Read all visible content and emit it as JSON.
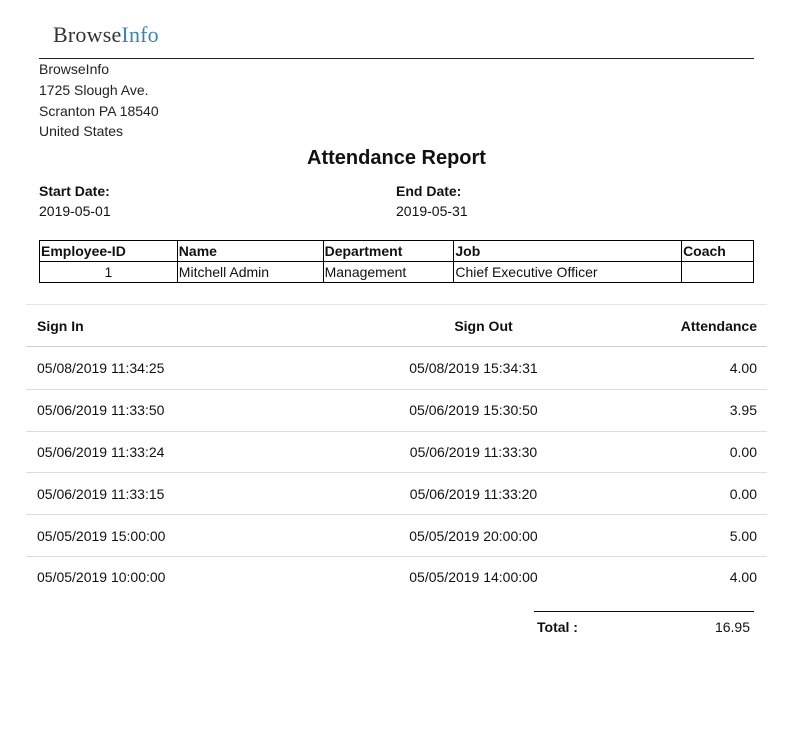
{
  "logo": {
    "part1": "Browse",
    "part2": "Info"
  },
  "address": {
    "company": "BrowseInfo",
    "street": "1725 Slough Ave.",
    "city": "Scranton PA 18540",
    "country": "United States"
  },
  "report": {
    "title": "Attendance Report",
    "start_label": "Start Date:",
    "start_value": "2019-05-01",
    "end_label": "End Date:",
    "end_value": "2019-05-31"
  },
  "employee_table": {
    "headers": [
      "Employee-ID",
      "Name",
      "Department",
      "Job",
      "Coach"
    ],
    "row": [
      "1",
      "Mitchell Admin",
      "Management",
      "Chief Executive Officer",
      ""
    ]
  },
  "attendance": {
    "headers": {
      "sign_in": "Sign In",
      "sign_out": "Sign Out",
      "attendance": "Attendance"
    },
    "rows": [
      {
        "sign_in": "05/08/2019 11:34:25",
        "sign_out": "05/08/2019 15:34:31",
        "attendance": "4.00"
      },
      {
        "sign_in": "05/06/2019 11:33:50",
        "sign_out": "05/06/2019 15:30:50",
        "attendance": "3.95"
      },
      {
        "sign_in": "05/06/2019 11:33:24",
        "sign_out": "05/06/2019 11:33:30",
        "attendance": "0.00"
      },
      {
        "sign_in": "05/06/2019 11:33:15",
        "sign_out": "05/06/2019 11:33:20",
        "attendance": "0.00"
      },
      {
        "sign_in": "05/05/2019 15:00:00",
        "sign_out": "05/05/2019 20:00:00",
        "attendance": "5.00"
      },
      {
        "sign_in": "05/05/2019 10:00:00",
        "sign_out": "05/05/2019 14:00:00",
        "attendance": "4.00"
      }
    ],
    "total_label": "Total :",
    "total_value": "16.95"
  }
}
